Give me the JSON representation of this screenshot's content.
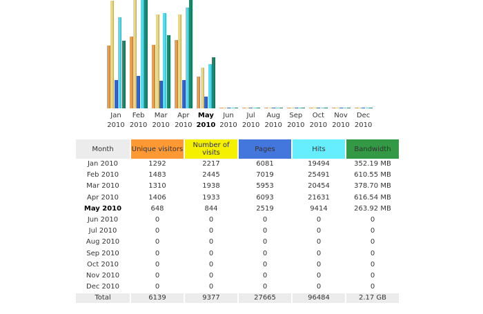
{
  "chart_data": {
    "type": "bar",
    "categories": [
      "Jan",
      "Feb",
      "Mar",
      "Apr",
      "May",
      "Jun",
      "Jul",
      "Aug",
      "Sep",
      "Oct",
      "Nov",
      "Dec"
    ],
    "year": "2010",
    "current_month_index": 4,
    "series": [
      {
        "name": "Unique visitors",
        "color": "#E8A050",
        "values": [
          1292,
          1483,
          1310,
          1406,
          648,
          0,
          0,
          0,
          0,
          0,
          0,
          0
        ]
      },
      {
        "name": "Number of visits",
        "color": "#E8D888",
        "values": [
          2217,
          2445,
          1938,
          1933,
          844,
          0,
          0,
          0,
          0,
          0,
          0,
          0
        ]
      },
      {
        "name": "Pages",
        "color": "#3366CC",
        "values": [
          6081,
          7019,
          5953,
          6093,
          2519,
          0,
          0,
          0,
          0,
          0,
          0,
          0
        ]
      },
      {
        "name": "Hits",
        "color": "#55DDEE",
        "values": [
          19494,
          25491,
          20454,
          21631,
          9414,
          0,
          0,
          0,
          0,
          0,
          0,
          0
        ]
      },
      {
        "name": "Bandwidth (MB)",
        "color": "#1A8A6A",
        "values": [
          352.19,
          610.55,
          378.7,
          616.54,
          263.92,
          0,
          0,
          0,
          0,
          0,
          0,
          0
        ]
      }
    ]
  },
  "table": {
    "headers": [
      {
        "label": "Month",
        "bg": "#ECECEC"
      },
      {
        "label": "Unique visitors",
        "bg": "#FF9933"
      },
      {
        "label": "Number of visits",
        "bg": "#F4F000"
      },
      {
        "label": "Pages",
        "bg": "#4477DD"
      },
      {
        "label": "Hits",
        "bg": "#66EEFF"
      },
      {
        "label": "Bandwidth",
        "bg": "#339944"
      }
    ],
    "rows": [
      [
        "Jan 2010",
        "1292",
        "2217",
        "6081",
        "19494",
        "352.19 MB"
      ],
      [
        "Feb 2010",
        "1483",
        "2445",
        "7019",
        "25491",
        "610.55 MB"
      ],
      [
        "Mar 2010",
        "1310",
        "1938",
        "5953",
        "20454",
        "378.70 MB"
      ],
      [
        "Apr 2010",
        "1406",
        "1933",
        "6093",
        "21631",
        "616.54 MB"
      ],
      [
        "May 2010",
        "648",
        "844",
        "2519",
        "9414",
        "263.92 MB"
      ],
      [
        "Jun 2010",
        "0",
        "0",
        "0",
        "0",
        "0"
      ],
      [
        "Jul 2010",
        "0",
        "0",
        "0",
        "0",
        "0"
      ],
      [
        "Aug 2010",
        "0",
        "0",
        "0",
        "0",
        "0"
      ],
      [
        "Sep 2010",
        "0",
        "0",
        "0",
        "0",
        "0"
      ],
      [
        "Oct 2010",
        "0",
        "0",
        "0",
        "0",
        "0"
      ],
      [
        "Nov 2010",
        "0",
        "0",
        "0",
        "0",
        "0"
      ],
      [
        "Dec 2010",
        "0",
        "0",
        "0",
        "0",
        "0"
      ]
    ],
    "total": [
      "Total",
      "6139",
      "9377",
      "27665",
      "96484",
      "2.17 GB"
    ]
  }
}
